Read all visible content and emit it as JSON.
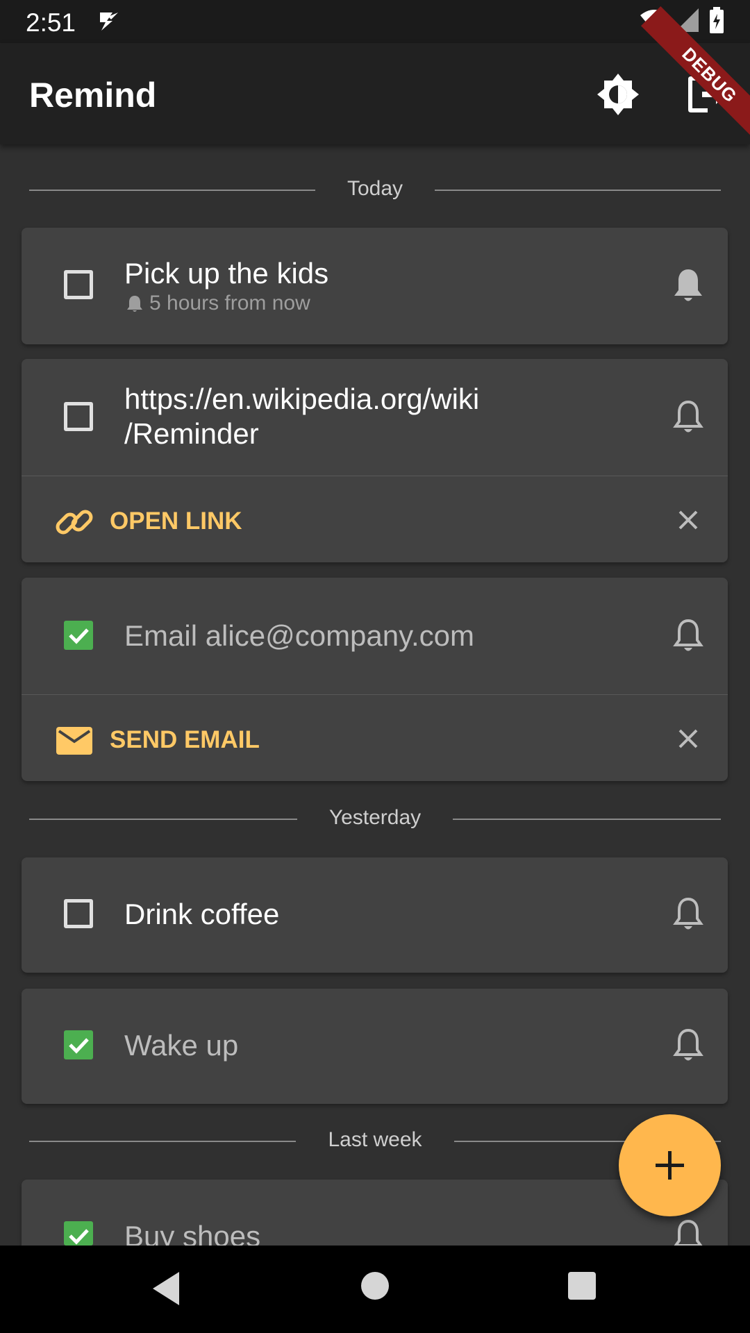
{
  "status_bar": {
    "time": "2:51",
    "debug_label": "DEBUG"
  },
  "app_bar": {
    "title": "Remind",
    "brightness_icon": "brightness-icon",
    "logout_icon": "logout-icon"
  },
  "sections": [
    {
      "label": "Today"
    },
    {
      "label": "Yesterday"
    },
    {
      "label": "Last week"
    }
  ],
  "items": [
    {
      "title": "Pick up the kids",
      "checked": false,
      "subtitle": "5 hours from now",
      "bell": "bell-active-icon"
    },
    {
      "title_line1": "https://en.wikipedia.org/wiki",
      "title_line2": "/Reminder",
      "checked": false,
      "bell": "bell-outline-icon",
      "action": {
        "label": "OPEN LINK",
        "icon": "link-icon"
      }
    },
    {
      "title": "Email alice@company.com",
      "checked": true,
      "bell": "bell-outline-icon",
      "action": {
        "label": "SEND EMAIL",
        "icon": "email-icon"
      }
    },
    {
      "title": "Drink coffee",
      "checked": false,
      "bell": "bell-outline-icon"
    },
    {
      "title": "Wake up",
      "checked": true,
      "bell": "bell-outline-icon"
    },
    {
      "title": "Buy shoes",
      "checked": true,
      "bell": "bell-outline-icon"
    }
  ],
  "colors": {
    "accent": "#ffb74d",
    "action_text": "#ffc966",
    "checkbox_checked": "#4caf50",
    "card_bg": "#424242",
    "page_bg": "#303030"
  }
}
